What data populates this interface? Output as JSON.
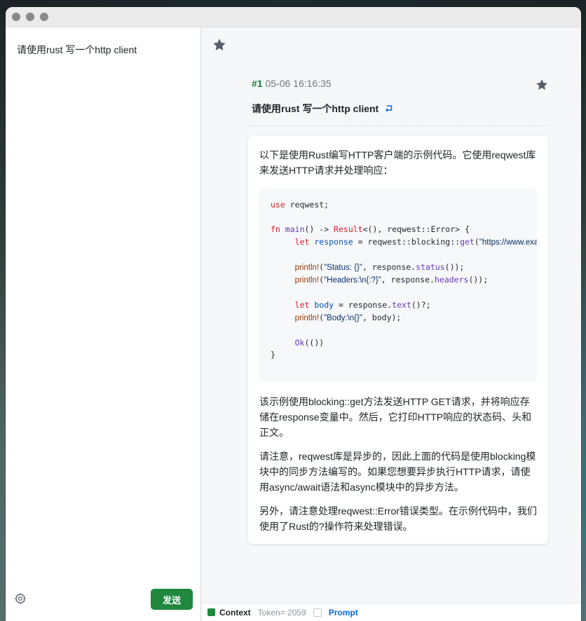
{
  "sidebar": {
    "prompt": "请使用rust 写一个http client",
    "send_label": "发送"
  },
  "message": {
    "number": "#1",
    "timestamp": "05-06 16:16:35",
    "title": "请使用rust 写一个http client",
    "intro": "以下是使用Rust编写HTTP客户端的示例代码。它使用reqwest库来发送HTTP请求并处理响应：",
    "code": {
      "l1_kw": "use",
      "l1_rest": " reqwest;",
      "l2_kw": "fn",
      "l2_fn": "main",
      "l2_a": "() -> ",
      "l2_res": "Result",
      "l2_b": "<(), reqwest::Error> {",
      "l3_kw": "let",
      "l3_var": "response",
      "l3_a": " = reqwest::blocking::",
      "l3_fn": "get",
      "l3_b": "(",
      "l3_str": "\"https://www.exa",
      "l4_mac": "println!",
      "l4_a": "(",
      "l4_str": "\"Status: {}\"",
      "l4_b": ", response.",
      "l4_fn": "status",
      "l4_c": "());",
      "l5_mac": "println!",
      "l5_a": "(",
      "l5_str": "\"Headers:\\n{:?}\"",
      "l5_b": ", response.",
      "l5_fn": "headers",
      "l5_c": "());",
      "l6_kw": "let",
      "l6_var": "body",
      "l6_a": " = response.",
      "l6_fn": "text",
      "l6_b": "()?;",
      "l7_mac": "println!",
      "l7_a": "(",
      "l7_str": "\"Body:\\n{}\"",
      "l7_b": ", body);",
      "l8_fn": "Ok",
      "l8_a": "(())",
      "l9": "}"
    },
    "para1": "该示例使用blocking::get方法发送HTTP GET请求，并将响应存储在response变量中。然后，它打印HTTP响应的状态码、头和正文。",
    "para2": "请注意，reqwest库是异步的，因此上面的代码是使用blocking模块中的同步方法编写的。如果您想要异步执行HTTP请求，请使用async/await语法和async模块中的异步方法。",
    "para3": "另外，请注意处理reqwest::Error错误类型。在示例代码中，我们使用了Rust的?操作符来处理错误。"
  },
  "footer": {
    "context_label": "Context",
    "token_text": "Token= 2059",
    "prompt_label": "Prompt"
  },
  "icons": {
    "star": "star-icon",
    "gear": "gear-icon",
    "retry": "retry-icon"
  },
  "colors": {
    "accent_green": "#1f883d",
    "link_blue": "#0969da"
  }
}
